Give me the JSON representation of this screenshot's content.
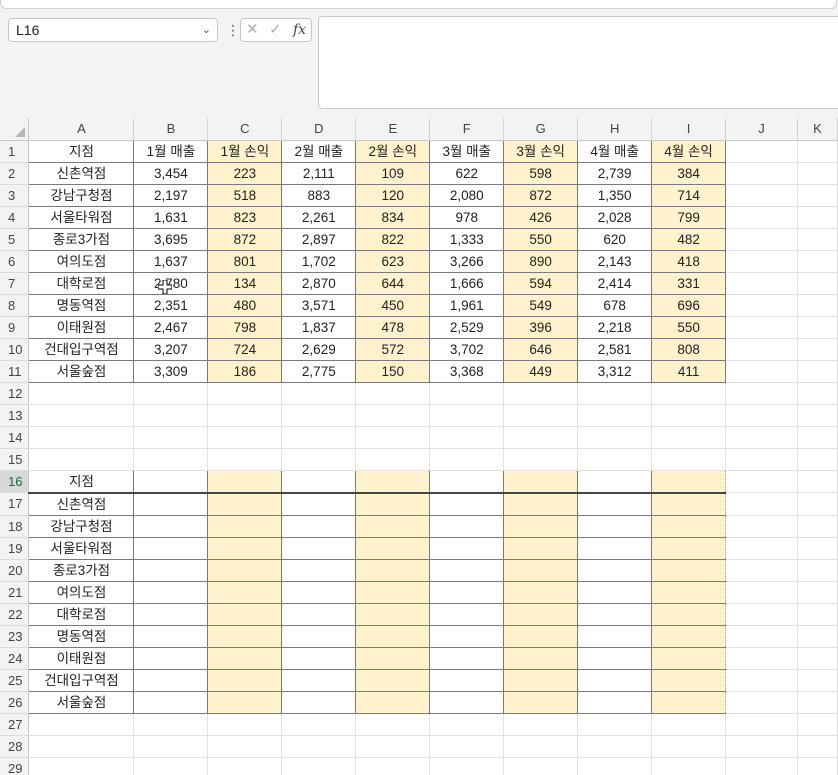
{
  "formula_bar": {
    "name_box": "L16",
    "more_icon": "⋮",
    "cancel_icon": "✕",
    "enter_icon": "✓",
    "fx_label": "fx",
    "formula": ""
  },
  "columns": [
    "A",
    "B",
    "C",
    "D",
    "E",
    "F",
    "G",
    "H",
    "I",
    "J",
    "K"
  ],
  "rows": [
    {
      "n": "1",
      "cells": [
        "지점",
        "1월 매출",
        "1월 손익",
        "2월 매출",
        "2월 손익",
        "3월 매출",
        "3월 손익",
        "4월 매출",
        "4월 손익"
      ]
    },
    {
      "n": "2",
      "cells": [
        "신촌역점",
        "3,454",
        "223",
        "2,111",
        "109",
        "622",
        "598",
        "2,739",
        "384"
      ]
    },
    {
      "n": "3",
      "cells": [
        "강남구청점",
        "2,197",
        "518",
        "883",
        "120",
        "2,080",
        "872",
        "1,350",
        "714"
      ]
    },
    {
      "n": "4",
      "cells": [
        "서울타워점",
        "1,631",
        "823",
        "2,261",
        "834",
        "978",
        "426",
        "2,028",
        "799"
      ]
    },
    {
      "n": "5",
      "cells": [
        "종로3가점",
        "3,695",
        "872",
        "2,897",
        "822",
        "1,333",
        "550",
        "620",
        "482"
      ]
    },
    {
      "n": "6",
      "cells": [
        "여의도점",
        "1,637",
        "801",
        "1,702",
        "623",
        "3,266",
        "890",
        "2,143",
        "418"
      ]
    },
    {
      "n": "7",
      "cells": [
        "대학로점",
        "2,780",
        "134",
        "2,870",
        "644",
        "1,666",
        "594",
        "2,414",
        "331"
      ]
    },
    {
      "n": "8",
      "cells": [
        "명동역점",
        "2,351",
        "480",
        "3,571",
        "450",
        "1,961",
        "549",
        "678",
        "696"
      ]
    },
    {
      "n": "9",
      "cells": [
        "이태원점",
        "2,467",
        "798",
        "1,837",
        "478",
        "2,529",
        "396",
        "2,218",
        "550"
      ]
    },
    {
      "n": "10",
      "cells": [
        "건대입구역점",
        "3,207",
        "724",
        "2,629",
        "572",
        "3,702",
        "646",
        "2,581",
        "808"
      ]
    },
    {
      "n": "11",
      "cells": [
        "서울숲점",
        "3,309",
        "186",
        "2,775",
        "150",
        "3,368",
        "449",
        "3,312",
        "411"
      ]
    },
    {
      "n": "12",
      "cells": []
    },
    {
      "n": "13",
      "cells": []
    },
    {
      "n": "14",
      "cells": []
    },
    {
      "n": "15",
      "cells": []
    },
    {
      "n": "16",
      "cells": [
        "지점",
        "",
        "",
        "",
        "",
        "",
        "",
        "",
        ""
      ]
    },
    {
      "n": "17",
      "cells": [
        "신촌역점",
        "",
        "",
        "",
        "",
        "",
        "",
        "",
        ""
      ]
    },
    {
      "n": "18",
      "cells": [
        "강남구청점",
        "",
        "",
        "",
        "",
        "",
        "",
        "",
        ""
      ]
    },
    {
      "n": "19",
      "cells": [
        "서울타워점",
        "",
        "",
        "",
        "",
        "",
        "",
        "",
        ""
      ]
    },
    {
      "n": "20",
      "cells": [
        "종로3가점",
        "",
        "",
        "",
        "",
        "",
        "",
        "",
        ""
      ]
    },
    {
      "n": "21",
      "cells": [
        "여의도점",
        "",
        "",
        "",
        "",
        "",
        "",
        "",
        ""
      ]
    },
    {
      "n": "22",
      "cells": [
        "대학로점",
        "",
        "",
        "",
        "",
        "",
        "",
        "",
        ""
      ]
    },
    {
      "n": "23",
      "cells": [
        "명동역점",
        "",
        "",
        "",
        "",
        "",
        "",
        "",
        ""
      ]
    },
    {
      "n": "24",
      "cells": [
        "이태원점",
        "",
        "",
        "",
        "",
        "",
        "",
        "",
        ""
      ]
    },
    {
      "n": "25",
      "cells": [
        "건대입구역점",
        "",
        "",
        "",
        "",
        "",
        "",
        "",
        ""
      ]
    },
    {
      "n": "26",
      "cells": [
        "서울숲점",
        "",
        "",
        "",
        "",
        "",
        "",
        "",
        ""
      ]
    },
    {
      "n": "27",
      "cells": []
    },
    {
      "n": "28",
      "cells": []
    },
    {
      "n": "29",
      "cells": []
    }
  ],
  "colors": {
    "profit_fill": "#fff2cc",
    "selected_row_header": "#d8d8d8"
  }
}
